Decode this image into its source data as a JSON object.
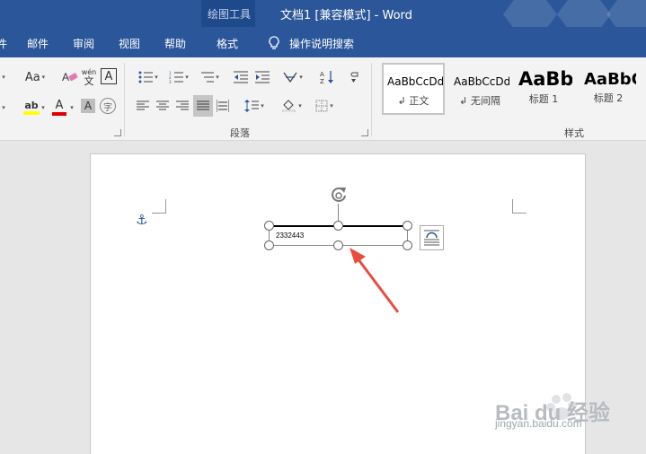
{
  "window": {
    "context_title": "绘图工具",
    "doc_title": "文档1 [兼容模式] - Word"
  },
  "tabs": [
    {
      "label": "邮件"
    },
    {
      "label": "审阅"
    },
    {
      "label": "视图"
    },
    {
      "label": "帮助"
    },
    {
      "label": "格式",
      "active": true
    }
  ],
  "tellme": {
    "label": "操作说明搜索",
    "icon": "lightbulb-icon"
  },
  "ribbon": {
    "font_group": {
      "font_size_button": "Aa",
      "phonetic_top": "wén",
      "phonetic_bottom": "文",
      "border_char": "A",
      "highlight_label": "ab",
      "font_color_label": "A",
      "shading_char": "A",
      "enclose_char": "字"
    },
    "paragraph_group": {
      "label": "段落"
    },
    "styles_group": {
      "label": "样式",
      "items": [
        {
          "sample": "AaBbCcDd",
          "name": "正文",
          "selected": true
        },
        {
          "sample": "AaBbCcDd",
          "name": "无间隔",
          "selected": false
        },
        {
          "sample": "AaBb",
          "name": "标题 1",
          "selected": false
        },
        {
          "sample": "AaBbC",
          "name": "标题 2",
          "selected": false
        }
      ]
    }
  },
  "document": {
    "textbox_text": "2332443"
  },
  "colors": {
    "title_bar": "#2b579a",
    "ribbon_bg": "#f3f3f3",
    "arrow": "#e84c3d"
  },
  "watermark": {
    "main": "Bai du 经验",
    "sub": "jingyan.baidu.com"
  }
}
